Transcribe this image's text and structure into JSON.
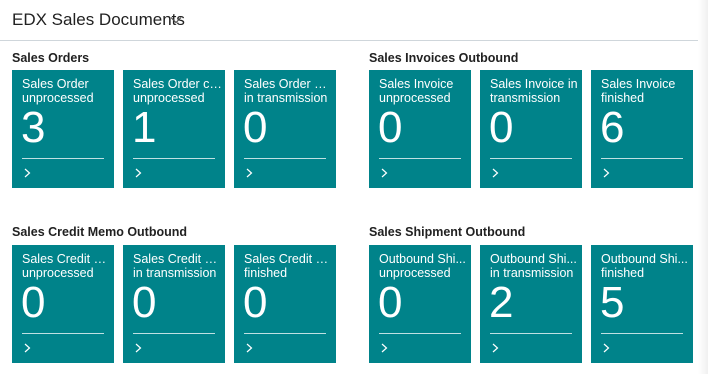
{
  "page": {
    "title": "EDX Sales Documents",
    "title_icon": "chevron-down-icon",
    "accent": "#00838a"
  },
  "groups": [
    {
      "title": "Sales Orders",
      "tiles": [
        {
          "line1": "Sales Order",
          "line2": "unprocessed",
          "value": "3"
        },
        {
          "line1": "Sales Order ch...",
          "line2": "unprocessed",
          "value": "1"
        },
        {
          "line1": "Sales Order Co...",
          "line2": "in transmission",
          "value": "0"
        }
      ]
    },
    {
      "title": "Sales Invoices Outbound",
      "tiles": [
        {
          "line1": "Sales Invoice",
          "line2": "unprocessed",
          "value": "0"
        },
        {
          "line1": "Sales Invoice in",
          "line2": "transmission",
          "value": "0"
        },
        {
          "line1": "Sales Invoice",
          "line2": "finished",
          "value": "6"
        }
      ]
    },
    {
      "title": "Sales Credit Memo Outbound",
      "tiles": [
        {
          "line1": "Sales Credit M...",
          "line2": "unprocessed",
          "value": "0"
        },
        {
          "line1": "Sales Credit M...",
          "line2": "in transmission",
          "value": "0"
        },
        {
          "line1": "Sales Credit M...",
          "line2": "finished",
          "value": "0"
        }
      ]
    },
    {
      "title": "Sales Shipment Outbound",
      "tiles": [
        {
          "line1": "Outbound Shi...",
          "line2": "unprocessed",
          "value": "0"
        },
        {
          "line1": "Outbound Shi...",
          "line2": "in transmission",
          "value": "2"
        },
        {
          "line1": "Outbound Shi...",
          "line2": "finished",
          "value": "5"
        }
      ]
    }
  ]
}
